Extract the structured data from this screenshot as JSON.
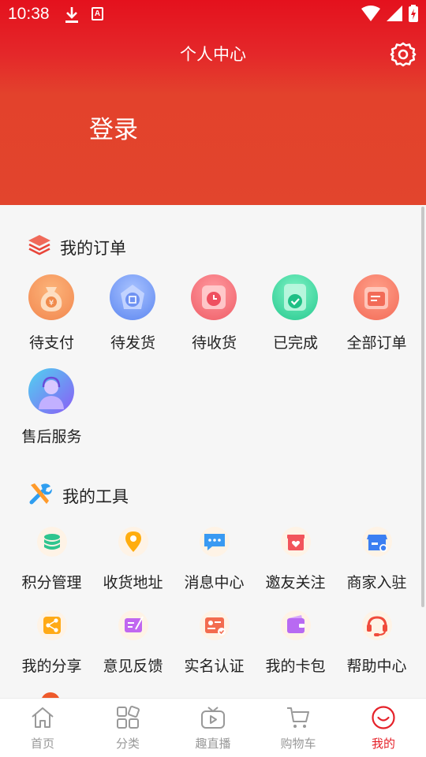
{
  "status_bar": {
    "time": "10:38"
  },
  "header": {
    "title": "个人中心",
    "login_label": "登录"
  },
  "orders": {
    "title": "我的订单",
    "items": [
      {
        "label": "待支付",
        "icon": "wallet-icon"
      },
      {
        "label": "待发货",
        "icon": "package-icon"
      },
      {
        "label": "待收货",
        "icon": "clock-icon"
      },
      {
        "label": "已完成",
        "icon": "check-icon"
      },
      {
        "label": "全部订单",
        "icon": "list-icon"
      },
      {
        "label": "售后服务",
        "icon": "customer-service-icon"
      }
    ]
  },
  "tools": {
    "title": "我的工具",
    "items": [
      {
        "label": "积分管理",
        "icon": "points-icon"
      },
      {
        "label": "收货地址",
        "icon": "location-icon"
      },
      {
        "label": "消息中心",
        "icon": "message-icon"
      },
      {
        "label": "邀友关注",
        "icon": "gift-icon"
      },
      {
        "label": "商家入驻",
        "icon": "store-icon"
      },
      {
        "label": "我的分享",
        "icon": "share-icon"
      },
      {
        "label": "意见反馈",
        "icon": "feedback-icon"
      },
      {
        "label": "实名认证",
        "icon": "id-card-icon"
      },
      {
        "label": "我的卡包",
        "icon": "card-wallet-icon"
      },
      {
        "label": "帮助中心",
        "icon": "headset-icon"
      }
    ]
  },
  "tabbar": {
    "items": [
      {
        "label": "首页",
        "icon": "home-icon"
      },
      {
        "label": "分类",
        "icon": "category-icon"
      },
      {
        "label": "趣直播",
        "icon": "live-tv-icon"
      },
      {
        "label": "购物车",
        "icon": "cart-icon"
      },
      {
        "label": "我的",
        "icon": "profile-smile-icon",
        "active": true
      }
    ]
  },
  "colors": {
    "brand_red": "#e5222a",
    "header_top": "#e4111d",
    "header_bottom": "#e2452d",
    "tab_inactive": "#999999"
  }
}
